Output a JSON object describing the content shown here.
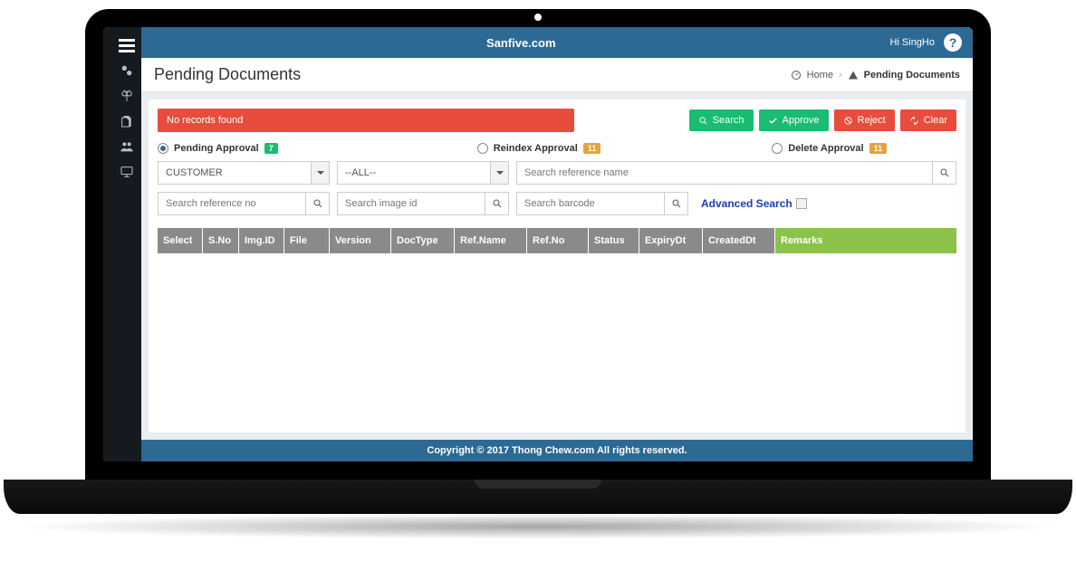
{
  "topbar": {
    "title": "Sanfive.com",
    "user_greeting": "Hi SingHo",
    "help": "?"
  },
  "page": {
    "title": "Pending Documents",
    "breadcrumb_home": "Home",
    "breadcrumb_current": "Pending Documents"
  },
  "alert": {
    "message": "No records found"
  },
  "actions": {
    "search": "Search",
    "approve": "Approve",
    "reject": "Reject",
    "clear": "Clear"
  },
  "approval_tabs": {
    "pending": {
      "label": "Pending Approval",
      "count": "7"
    },
    "reindex": {
      "label": "Reindex Approval",
      "count": "11"
    },
    "delete": {
      "label": "Delete Approval",
      "count": "11"
    }
  },
  "filters": {
    "customer_select": "CUSTOMER",
    "all_select": "--ALL--",
    "ref_name_ph": "Search reference name",
    "ref_no_ph": "Search reference no",
    "image_id_ph": "Search image id",
    "barcode_ph": "Search barcode",
    "advanced_label": "Advanced Search"
  },
  "table": {
    "cols": [
      "Select",
      "S.No",
      "Img.ID",
      "File",
      "Version",
      "DocType",
      "Ref.Name",
      "Ref.No",
      "Status",
      "ExpiryDt",
      "CreatedDt",
      "Remarks"
    ]
  },
  "footer": "Copyright © 2017 Thong Chew.com All rights reserved."
}
